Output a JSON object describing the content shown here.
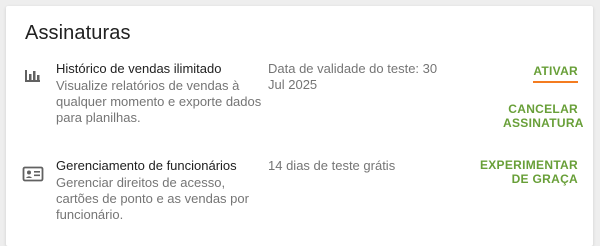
{
  "section": {
    "title": "Assinaturas"
  },
  "subscriptions": [
    {
      "icon": "bar-chart-icon",
      "name": "Histórico de vendas ilimitado",
      "description": "Visualize relatórios de vendas à qualquer momento e exporte dados para planilhas.",
      "status": "Data de validade do teste: 30 Jul 2025",
      "actions": [
        {
          "label": "ATIVAR"
        },
        {
          "label": "CANCELAR ASSINATURA"
        }
      ]
    },
    {
      "icon": "employee-badge-icon",
      "name": "Gerenciamento de funcionários",
      "description": "Gerenciar direitos de acesso, cartões de ponto e as vendas por funcionário.",
      "status": "14 dias de teste grátis",
      "actions": [
        {
          "label": "EXPERIMENTAR DE GRAÇA"
        }
      ]
    }
  ],
  "colors": {
    "action": "#689f38",
    "highlight": "#f47c20",
    "title": "#212121",
    "secondary_text": "#757575"
  }
}
